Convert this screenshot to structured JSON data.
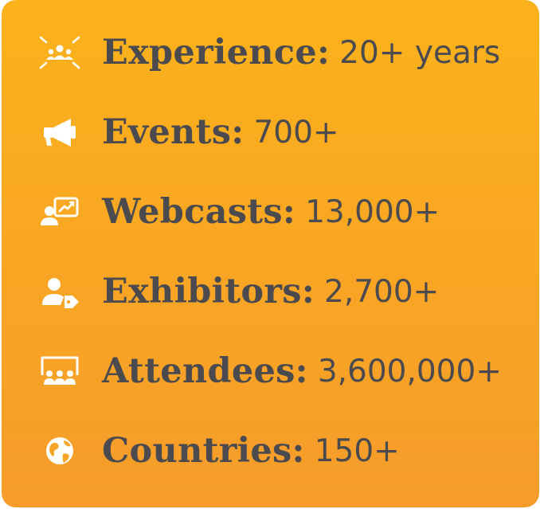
{
  "stats": [
    {
      "label": "Experience:",
      "value": "20+ years",
      "icon": "team-network-icon"
    },
    {
      "label": "Events:",
      "value": "700+",
      "icon": "megaphone-icon"
    },
    {
      "label": "Webcasts:",
      "value": "13,000+",
      "icon": "presentation-chart-icon"
    },
    {
      "label": "Exhibitors:",
      "value": "2,700+",
      "icon": "user-tag-icon"
    },
    {
      "label": "Attendees:",
      "value": "3,600,000+",
      "icon": "audience-icon"
    },
    {
      "label": "Countries:",
      "value": "150+",
      "icon": "globe-icon"
    }
  ],
  "colors": {
    "card_top": "#fbb21b",
    "card_bottom": "#f59c2b",
    "text": "#4a4a4f",
    "icon": "#ffffff"
  }
}
